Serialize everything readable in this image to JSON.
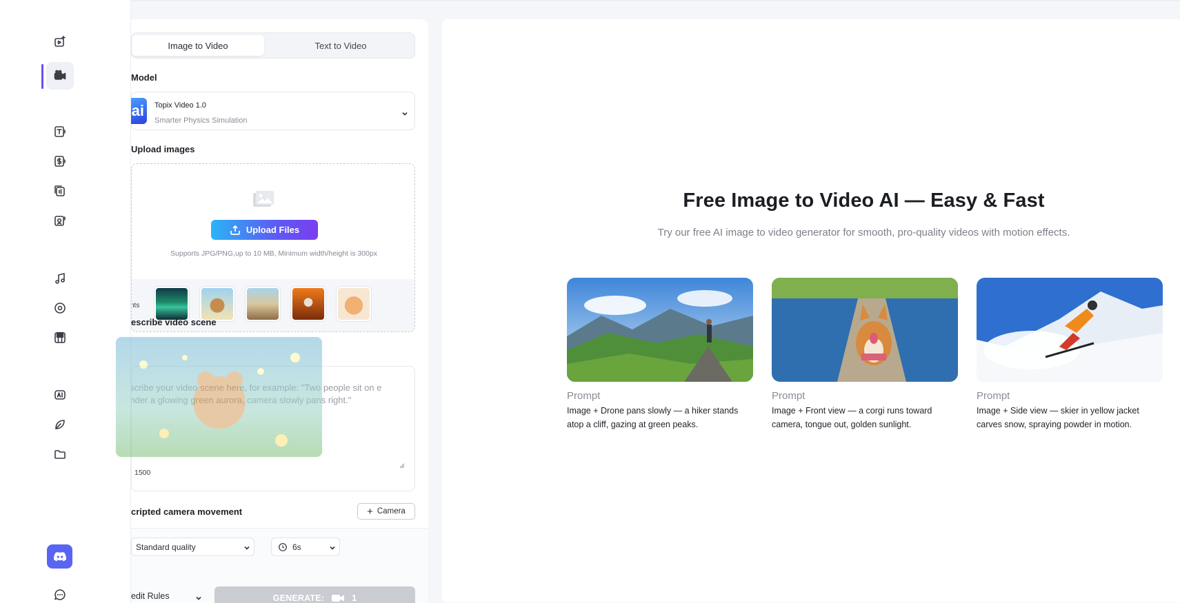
{
  "tabs": {
    "image_to_video": "Image to Video",
    "text_to_video": "Text to Video"
  },
  "model": {
    "section_label": "Model",
    "logo_text": "ai",
    "name": "Topix Video 1.0",
    "subtitle": "Smarter Physics Simulation"
  },
  "upload": {
    "section_label": "Upload images",
    "button_label": "Upload Files",
    "hint": "Supports JPG/PNG,up to 10 MB, Minimum width/height is 300px",
    "samples_label": "nts"
  },
  "scene": {
    "section_label": "escribe video scene",
    "placeholder": "escribe your video scene here, for example: \"Two people sit on e under a glowing green aurora, camera slowly pans right.\"",
    "counter": "1500"
  },
  "camera": {
    "section_label": "cripted camera movement",
    "button_label": "Camera"
  },
  "settings": {
    "quality": "Standard quality",
    "duration": "6s",
    "credit_rules": "edit Rules",
    "generate_label": "GENERATE:",
    "generate_cost": "1"
  },
  "hero": {
    "title": "Free Image to Video AI — Easy & Fast",
    "subtitle": "Try our free AI image to video generator for smooth, pro-quality videos with motion effects."
  },
  "examples": [
    {
      "label": "Prompt",
      "text": "Image + Drone pans slowly — a hiker stands atop a cliff, gazing at green peaks."
    },
    {
      "label": "Prompt",
      "text": "Image + Front view — a corgi runs toward camera, tongue out, golden sunlight."
    },
    {
      "label": "Prompt",
      "text": "Image + Side view — skier in yellow jacket carves snow, spraying powder in motion."
    }
  ],
  "rail_icons": [
    "video-add-icon",
    "video-camera-icon",
    "text-speech-icon",
    "dollar-speech-icon",
    "audio-copy-icon",
    "camera-audio-icon",
    "music-note-icon",
    "disc-icon",
    "piano-icon",
    "ai-badge-icon",
    "leaf-icon",
    "folder-icon",
    "discord-icon",
    "chat-icon"
  ],
  "colors": {
    "accent": "#6c4cf5",
    "upload_gradient_start": "#2cb4f6",
    "upload_gradient_end": "#7a3df0",
    "discord": "#5865f2",
    "generate_disabled": "#c9ccd1"
  }
}
